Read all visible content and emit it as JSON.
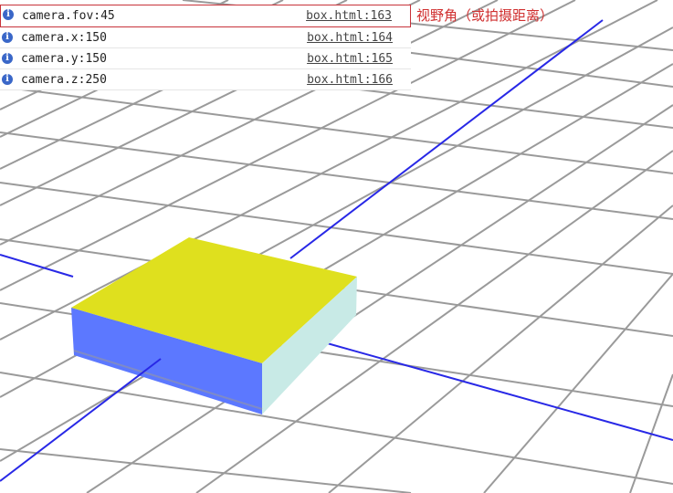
{
  "console": {
    "rows": [
      {
        "message": "camera.fov:45",
        "source": "box.html:163"
      },
      {
        "message": "camera.x:150",
        "source": "box.html:164"
      },
      {
        "message": "camera.y:150",
        "source": "box.html:165"
      },
      {
        "message": "camera.z:250",
        "source": "box.html:166"
      }
    ],
    "icon": "info-icon"
  },
  "annotation": {
    "text": "视野角（或拍摄距离）",
    "color": "#d03030"
  },
  "scene": {
    "grid_color": "#9a9a9a",
    "axis_color": "#2828e6",
    "box_top_color": "#dfe01e",
    "box_front_color": "#5c78ff",
    "box_side_color": "#c8eae6"
  }
}
